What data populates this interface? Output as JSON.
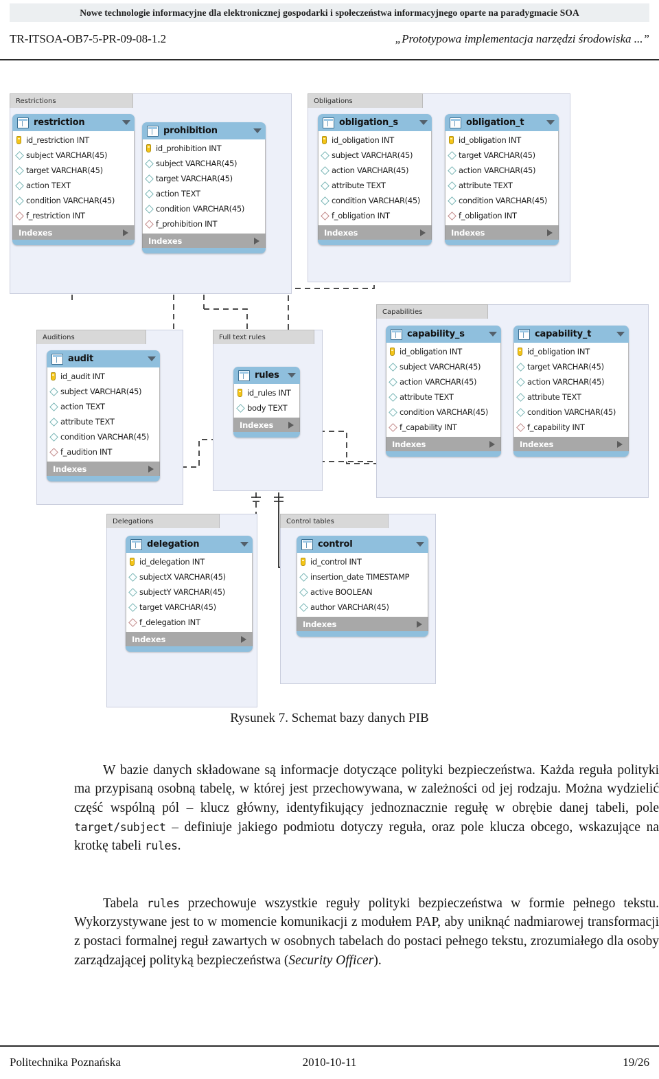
{
  "header": {
    "banner": "Nowe technologie informacyjne dla elektronicznej gospodarki i społeczeństwa informacyjnego oparte na paradygmacie SOA",
    "doc_id": "TR-ITSOA-OB7-5-PR-09-08-1.2",
    "doc_title": "„Prototypowa implementacja narzędzi środowiska ...”"
  },
  "figure": {
    "caption": "Rysunek 7. Schemat bazy danych PIB",
    "indexes_label": "Indexes",
    "groups": [
      {
        "id": "restrictions",
        "label": "Restrictions"
      },
      {
        "id": "obligations",
        "label": "Obligations"
      },
      {
        "id": "auditions",
        "label": "Auditions"
      },
      {
        "id": "fulltextrules",
        "label": "Full text rules"
      },
      {
        "id": "capabilities",
        "label": "Capabilities"
      },
      {
        "id": "delegations",
        "label": "Delegations"
      },
      {
        "id": "controltables",
        "label": "Control tables"
      }
    ],
    "tables": [
      {
        "id": "restriction",
        "name": "restriction",
        "columns": [
          {
            "text": "id_restriction INT",
            "kind": "pk"
          },
          {
            "text": "subject VARCHAR(45)",
            "kind": "col"
          },
          {
            "text": "target VARCHAR(45)",
            "kind": "col"
          },
          {
            "text": "action TEXT",
            "kind": "col"
          },
          {
            "text": "condition VARCHAR(45)",
            "kind": "col"
          },
          {
            "text": "f_restriction INT",
            "kind": "fk"
          }
        ]
      },
      {
        "id": "prohibition",
        "name": "prohibition",
        "columns": [
          {
            "text": "id_prohibition INT",
            "kind": "pk"
          },
          {
            "text": "subject VARCHAR(45)",
            "kind": "col"
          },
          {
            "text": "target VARCHAR(45)",
            "kind": "col"
          },
          {
            "text": "action TEXT",
            "kind": "col"
          },
          {
            "text": "condition VARCHAR(45)",
            "kind": "col"
          },
          {
            "text": "f_prohibition INT",
            "kind": "fk"
          }
        ]
      },
      {
        "id": "obligation_s",
        "name": "obligation_s",
        "columns": [
          {
            "text": "id_obligation INT",
            "kind": "pk"
          },
          {
            "text": "subject VARCHAR(45)",
            "kind": "col"
          },
          {
            "text": "action VARCHAR(45)",
            "kind": "col"
          },
          {
            "text": "attribute TEXT",
            "kind": "col"
          },
          {
            "text": "condition VARCHAR(45)",
            "kind": "col"
          },
          {
            "text": "f_obligation INT",
            "kind": "fk"
          }
        ]
      },
      {
        "id": "obligation_t",
        "name": "obligation_t",
        "columns": [
          {
            "text": "id_obligation INT",
            "kind": "pk"
          },
          {
            "text": "target VARCHAR(45)",
            "kind": "col"
          },
          {
            "text": "action VARCHAR(45)",
            "kind": "col"
          },
          {
            "text": "attribute TEXT",
            "kind": "col"
          },
          {
            "text": "condition VARCHAR(45)",
            "kind": "col"
          },
          {
            "text": "f_obligation INT",
            "kind": "fk"
          }
        ]
      },
      {
        "id": "audit",
        "name": "audit",
        "columns": [
          {
            "text": "id_audit INT",
            "kind": "pk"
          },
          {
            "text": "subject VARCHAR(45)",
            "kind": "col"
          },
          {
            "text": "action TEXT",
            "kind": "col"
          },
          {
            "text": "attribute TEXT",
            "kind": "col"
          },
          {
            "text": "condition VARCHAR(45)",
            "kind": "col"
          },
          {
            "text": "f_audition INT",
            "kind": "fk"
          }
        ]
      },
      {
        "id": "rules",
        "name": "rules",
        "columns": [
          {
            "text": "id_rules INT",
            "kind": "pk"
          },
          {
            "text": "body TEXT",
            "kind": "col"
          }
        ]
      },
      {
        "id": "capability_s",
        "name": "capability_s",
        "columns": [
          {
            "text": "id_obligation INT",
            "kind": "pk"
          },
          {
            "text": "subject VARCHAR(45)",
            "kind": "col"
          },
          {
            "text": "action VARCHAR(45)",
            "kind": "col"
          },
          {
            "text": "attribute TEXT",
            "kind": "col"
          },
          {
            "text": "condition VARCHAR(45)",
            "kind": "col"
          },
          {
            "text": "f_capability INT",
            "kind": "fk"
          }
        ]
      },
      {
        "id": "capability_t",
        "name": "capability_t",
        "columns": [
          {
            "text": "id_obligation INT",
            "kind": "pk"
          },
          {
            "text": "target VARCHAR(45)",
            "kind": "col"
          },
          {
            "text": "action VARCHAR(45)",
            "kind": "col"
          },
          {
            "text": "attribute TEXT",
            "kind": "col"
          },
          {
            "text": "condition VARCHAR(45)",
            "kind": "col"
          },
          {
            "text": "f_capability INT",
            "kind": "fk"
          }
        ]
      },
      {
        "id": "delegation",
        "name": "delegation",
        "columns": [
          {
            "text": "id_delegation INT",
            "kind": "pk"
          },
          {
            "text": "subjectX VARCHAR(45)",
            "kind": "col"
          },
          {
            "text": "subjectY VARCHAR(45)",
            "kind": "col"
          },
          {
            "text": "target VARCHAR(45)",
            "kind": "col"
          },
          {
            "text": "f_delegation INT",
            "kind": "fk"
          }
        ]
      },
      {
        "id": "control",
        "name": "control",
        "columns": [
          {
            "text": "id_control INT",
            "kind": "pk"
          },
          {
            "text": "insertion_date TIMESTAMP",
            "kind": "col"
          },
          {
            "text": "active BOOLEAN",
            "kind": "col"
          },
          {
            "text": "author VARCHAR(45)",
            "kind": "col"
          }
        ]
      }
    ]
  },
  "body": {
    "para1_a": "W bazie danych składowane są informacje dotyczące polityki bezpieczeństwa. Każda reguła polityki ma przypisaną osobną tabelę, w której  jest przechowywana, w zależności od jej rodzaju. Można wydzielić część wspólną pól – klucz główny, identyfikujący jednoznacznie regułę w obrębie danej tabeli, pole ",
    "para1_mono1": "target/subject",
    "para1_b": " – definiuje jakiego podmiotu dotyczy reguła, oraz pole klucza obcego, wskazujące na krotkę tabeli ",
    "para1_mono2": "rules",
    "para1_c": ".",
    "para2_a": "Tabela ",
    "para2_mono1": "rules",
    "para2_b": " przechowuje wszystkie reguły polityki bezpieczeństwa  w formie pełnego tekstu. Wykorzystywane jest to w momencie komunikacji z modułem PAP, aby uniknąć nadmiarowej transformacji z postaci formalnej reguł zawartych w osobnych tabelach do postaci pełnego tekstu, zrozumiałego dla osoby zarządzającej polityką bezpieczeństwa (",
    "para2_ital": "Security Officer",
    "para2_c": ")."
  },
  "footer": {
    "left": "Politechnika Poznańska",
    "center": "2010-10-11",
    "right": "19/26"
  },
  "colors": {
    "table_header": "#8fbfdd",
    "group_panel": "#edf0f9",
    "group_tab": "#d8d8d8",
    "indexes_bar": "#a8a8a8",
    "key_glyph": "#f5c518"
  }
}
